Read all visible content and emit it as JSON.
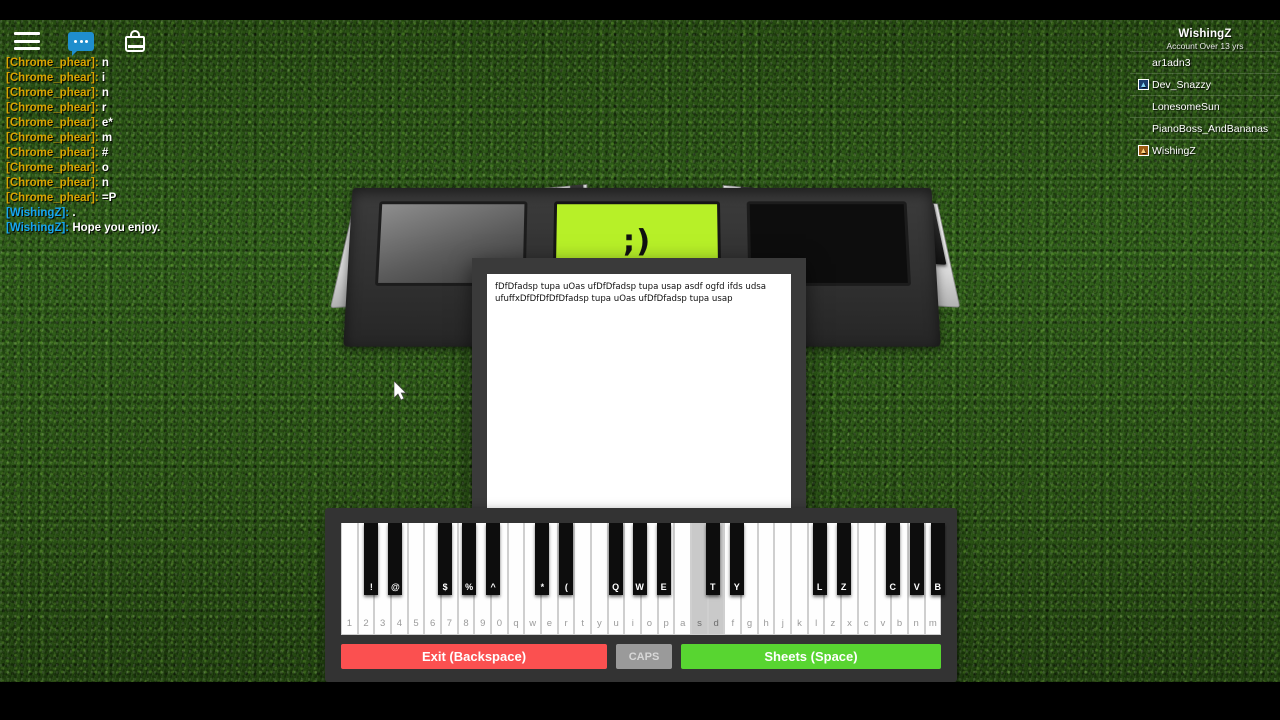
{
  "toolbar": {
    "menu_icon": "hamburger-menu-icon",
    "chat_icon": "chat-bubble-icon",
    "backpack_icon": "backpack-icon"
  },
  "chat": {
    "lines": [
      {
        "name": "[Chrome_phear]:",
        "message": "n",
        "self": false
      },
      {
        "name": "[Chrome_phear]:",
        "message": "i",
        "self": false
      },
      {
        "name": "[Chrome_phear]:",
        "message": "n",
        "self": false
      },
      {
        "name": "[Chrome_phear]:",
        "message": "r",
        "self": false
      },
      {
        "name": "[Chrome_phear]:",
        "message": "e*",
        "self": false
      },
      {
        "name": "[Chrome_phear]:",
        "message": "m",
        "self": false
      },
      {
        "name": "[Chrome_phear]:",
        "message": "#",
        "self": false
      },
      {
        "name": "[Chrome_phear]:",
        "message": "o",
        "self": false
      },
      {
        "name": "[Chrome_phear]:",
        "message": "n",
        "self": false
      },
      {
        "name": "[Chrome_phear]:",
        "message": "=P",
        "self": false
      },
      {
        "name": "[WishingZ]:",
        "message": ".",
        "self": true
      },
      {
        "name": "[WishingZ]:",
        "message": "Hope you enjoy.",
        "self": true
      }
    ]
  },
  "player_list": {
    "title": "WishingZ",
    "subtitle": "Account Over 13 yrs",
    "players": [
      {
        "name": "ar1adn3",
        "badge": ""
      },
      {
        "name": "Dev_Snazzy",
        "badge": "blue"
      },
      {
        "name": "LonesomeSun",
        "badge": ""
      },
      {
        "name": "PianoBoss_AndBananas",
        "badge": ""
      },
      {
        "name": "WishingZ",
        "badge": "gold"
      }
    ]
  },
  "piano_display": {
    "face": ";)"
  },
  "sheet": {
    "text": "fDfDfadsp tupa uOas ufDfDfadsp tupa usap asdf ogfd ifds udsa ufuffxDfDfDfDfDfadsp tupa uOas ufDfDfadsp tupa usap"
  },
  "keyboard": {
    "white_keys": [
      "1",
      "2",
      "3",
      "4",
      "5",
      "6",
      "7",
      "8",
      "9",
      "0",
      "q",
      "w",
      "e",
      "r",
      "t",
      "y",
      "u",
      "i",
      "o",
      "p",
      "a",
      "s",
      "d",
      "f",
      "g",
      "h",
      "j",
      "k",
      "l",
      "z",
      "x",
      "c",
      "v",
      "b",
      "n",
      "m"
    ],
    "active_white_keys": [
      "s",
      "d"
    ],
    "black_keys": [
      {
        "label": "!",
        "left_pct": 3.9
      },
      {
        "label": "@",
        "left_pct": 7.9
      },
      {
        "label": "$",
        "left_pct": 16.2
      },
      {
        "label": "%",
        "left_pct": 20.2
      },
      {
        "label": "^",
        "left_pct": 24.2
      },
      {
        "label": "*",
        "left_pct": 32.4
      },
      {
        "label": "(",
        "left_pct": 36.4
      },
      {
        "label": "Q",
        "left_pct": 44.6
      },
      {
        "label": "W",
        "left_pct": 48.6
      },
      {
        "label": "E",
        "left_pct": 52.6
      },
      {
        "label": "T",
        "left_pct": 60.8
      },
      {
        "label": "Y",
        "left_pct": 64.8
      },
      {
        "label": "L",
        "left_pct": 78.6
      },
      {
        "label": "Z",
        "left_pct": 82.6
      },
      {
        "label": "C",
        "left_pct": 90.8
      },
      {
        "label": "V",
        "left_pct": 94.8
      },
      {
        "label": "B",
        "left_pct": 98.3
      }
    ],
    "buttons": {
      "exit": "Exit (Backspace)",
      "caps": "CAPS",
      "sheets": "Sheets (Space)"
    }
  },
  "colors": {
    "grass": "#2e5a16",
    "exit_red": "#fb5050",
    "sheets_green": "#58d531",
    "caps_gray": "#9a9a9a",
    "display_green": "#b7f028",
    "chat_name": "#d9a400",
    "chat_self": "#16a6f0"
  }
}
